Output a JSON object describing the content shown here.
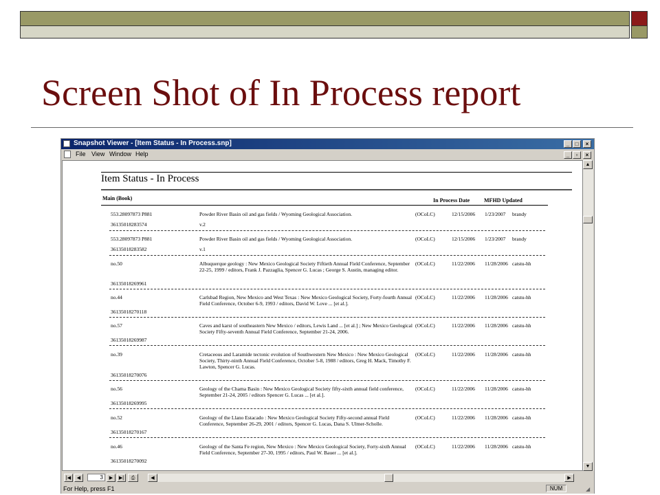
{
  "slide": {
    "title": "Screen Shot of In Process report"
  },
  "window": {
    "title": "Snapshot Viewer - [Item Status - In Process.snp]",
    "menu": [
      "File",
      "View",
      "Window",
      "Help"
    ],
    "status_text": "For Help, press F1",
    "num_indicator": "NUM",
    "page_number": "3"
  },
  "report": {
    "title": "Item Status - In Process",
    "section": "Main (Book)",
    "col_in_process_date": "In Process Date",
    "col_mfhd_updated": "MFHD Updated",
    "rows": [
      {
        "call": "553.28097873 P881",
        "barcode": "36135018283574",
        "title": "Powder River Basin oil and gas fields / Wyoming Geological Association.",
        "vol": "v.2",
        "source": "(OCoLC)",
        "in_process": "12/15/2006",
        "mfhd": "1/23/2007",
        "user": "brandy"
      },
      {
        "call": "553.28097873 P881",
        "barcode": "36135018283582",
        "title": "Powder River Basin oil and gas fields / Wyoming Geological Association.",
        "vol": "v.1",
        "source": "(OCoLC)",
        "in_process": "12/15/2006",
        "mfhd": "1/23/2007",
        "user": "brandy"
      },
      {
        "call": "no.50",
        "barcode": "36135018269961",
        "title": "Albuquerque geology : New Mexico Geological Society Fiftieth Annual Field Conference, September 22-25, 1999 / editors, Frank J. Pazzaglia, Spencer G. Lucas ; George S. Austin, managing editor.",
        "vol": "",
        "source": "(OCoLC)",
        "in_process": "11/22/2006",
        "mfhd": "11/28/2006",
        "user": "catstu-hh"
      },
      {
        "call": "no.44",
        "barcode": "36135018270118",
        "title": "Carlsbad Region, New Mexico and West Texas : New Mexico Geological Society, Forty-fourth Annual Field Conference, October 6-9, 1993 / editors, David W. Love ... [et al.].",
        "vol": "",
        "source": "(OCoLC)",
        "in_process": "11/22/2006",
        "mfhd": "11/28/2006",
        "user": "catstu-hh"
      },
      {
        "call": "no.57",
        "barcode": "36135018269987",
        "title": "Caves and karst of southeastern New Mexico / editors, Lewis Land ... [et al.] ; New Mexico Geological Society Fifty-seventh Annual Field Conference, September 21-24, 2006.",
        "vol": "",
        "source": "(OCoLC)",
        "in_process": "11/22/2006",
        "mfhd": "11/28/2006",
        "user": "catstu-hh"
      },
      {
        "call": "no.39",
        "barcode": "36135018270076",
        "title": "Cretaceous and Laramide tectonic evolution of Southwestern New Mexico : New Mexico Geological Society, Thirty-ninth Annual Field Conference, October 5-8, 1988 / editors, Greg H. Mack, Timothy F. Lawton, Spencer G. Lucas.",
        "vol": "",
        "source": "(OCoLC)",
        "in_process": "11/22/2006",
        "mfhd": "11/28/2006",
        "user": "catstu-hh"
      },
      {
        "call": "no.56",
        "barcode": "36135018269995",
        "title": "Geology of the Chama Basin : New Mexico Geological Society fifty-sixth annual field conference, September 21-24, 2005 / editors Spencer G. Lucas ... [et al.].",
        "vol": "",
        "source": "(OCoLC)",
        "in_process": "11/22/2006",
        "mfhd": "11/28/2006",
        "user": "catstu-hh"
      },
      {
        "call": "no.52",
        "barcode": "36135018270167",
        "title": "Geology of the Llano Estacado : New Mexico Geological Society Fifty-second annual Field Conference, September 26-29, 2001 / editors, Spencer G. Lucas, Dana S. Ulmer-Scholle.",
        "vol": "",
        "source": "(OCoLC)",
        "in_process": "11/22/2006",
        "mfhd": "11/28/2006",
        "user": "catstu-hh"
      },
      {
        "call": "no.46",
        "barcode": "36135018270092",
        "title": "Geology of the Santa Fe region, New Mexico : New Mexico Geological Society, Forty-sixth Annual Field Conference, September 27-30, 1995 / editors, Paul W. Bauer ... [et al.].",
        "vol": "",
        "source": "(OCoLC)",
        "in_process": "11/22/2006",
        "mfhd": "11/28/2006",
        "user": "catstu-hh"
      }
    ]
  }
}
